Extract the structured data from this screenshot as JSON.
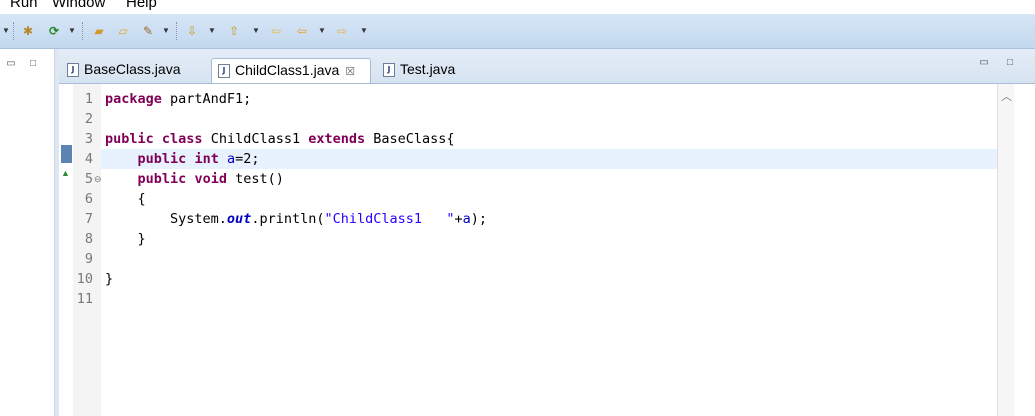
{
  "menubar": {
    "items": [
      "Run",
      "Window",
      "Help"
    ]
  },
  "toolbar": {
    "icons": [
      "debug-icon",
      "run-icon",
      "open-folder-icon",
      "open-type-icon",
      "wand-icon",
      "next-annotation-icon",
      "prev-annotation-icon",
      "back-icon",
      "forward-icon"
    ]
  },
  "tabs": [
    {
      "label": "BaseClass.java",
      "active": false
    },
    {
      "label": "ChildClass1.java",
      "active": true,
      "close": "☒"
    },
    {
      "label": "Test.java",
      "active": false
    }
  ],
  "editor": {
    "line_numbers": [
      "1",
      "2",
      "3",
      "4",
      "5",
      "6",
      "7",
      "8",
      "9",
      "10",
      "11"
    ],
    "current_line": 4,
    "lines": [
      [
        [
          "kw",
          "package"
        ],
        [
          "t",
          " partAndF1;"
        ]
      ],
      [],
      [
        [
          "kw",
          "public"
        ],
        [
          "t",
          " "
        ],
        [
          "kw",
          "class"
        ],
        [
          "t",
          " ChildClass1 "
        ],
        [
          "kw",
          "extends"
        ],
        [
          "t",
          " BaseClass{"
        ]
      ],
      [
        [
          "t",
          "    "
        ],
        [
          "kw",
          "public"
        ],
        [
          "t",
          " "
        ],
        [
          "kw",
          "int"
        ],
        [
          "t",
          " "
        ],
        [
          "fld",
          "a"
        ],
        [
          "t",
          "=2;"
        ]
      ],
      [
        [
          "t",
          "    "
        ],
        [
          "kw",
          "public"
        ],
        [
          "t",
          " "
        ],
        [
          "kw",
          "void"
        ],
        [
          "t",
          " test()"
        ]
      ],
      [
        [
          "t",
          "    {"
        ]
      ],
      [
        [
          "t",
          "        System."
        ],
        [
          "sfld",
          "out"
        ],
        [
          "t",
          ".println("
        ],
        [
          "str",
          "\"ChildClass1   \""
        ],
        [
          "t",
          "+"
        ],
        [
          "fld",
          "a"
        ],
        [
          "t",
          ");"
        ]
      ],
      [
        [
          "t",
          "    }"
        ]
      ],
      [],
      [
        [
          "t",
          "}"
        ]
      ],
      []
    ]
  },
  "colors": {
    "keyword": "#7f0055",
    "field": "#0000c0",
    "string": "#2a00ff",
    "current_line_bg": "#e8f2fe"
  }
}
